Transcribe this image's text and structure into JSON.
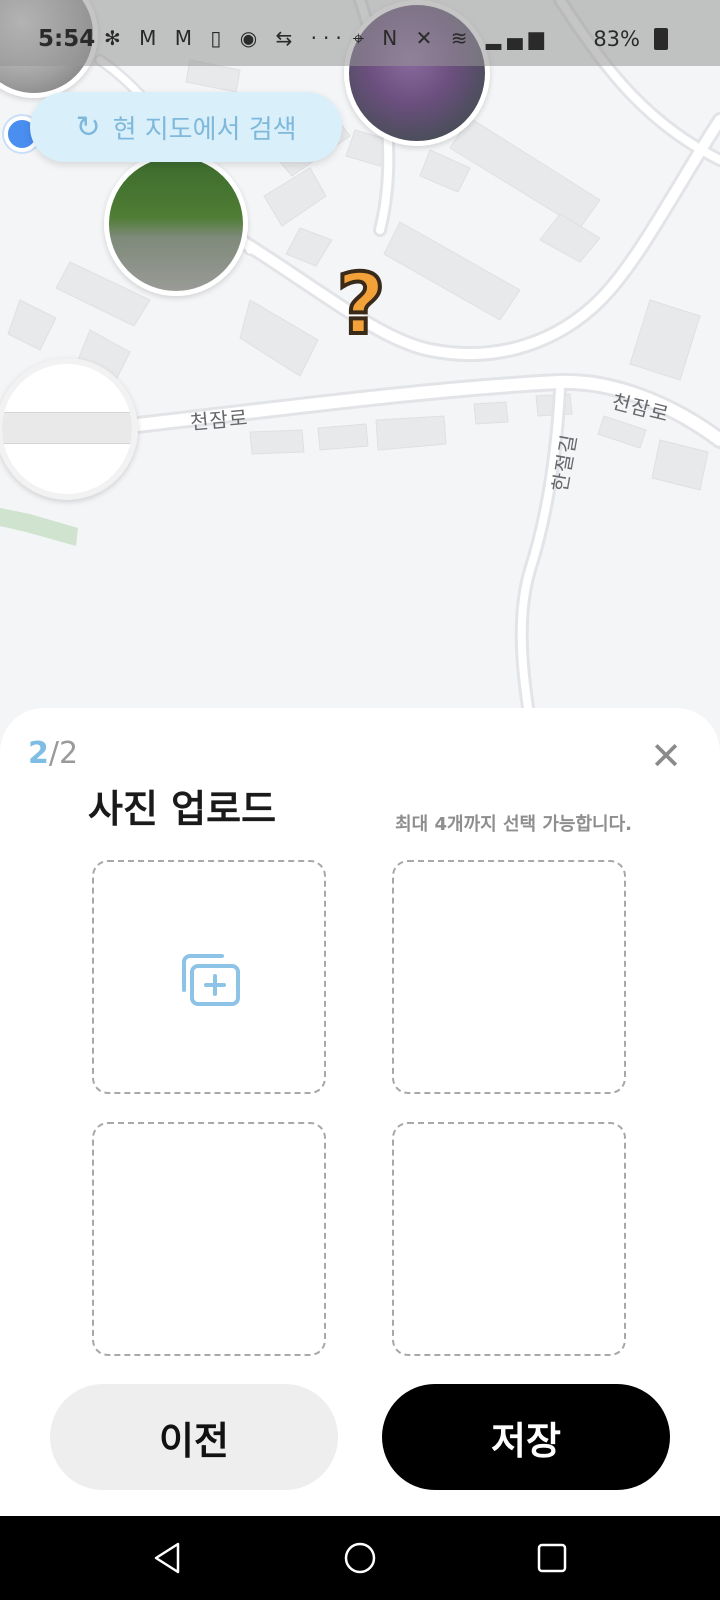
{
  "status_bar": {
    "time": "5:54",
    "left_icons": "✻ M M ▯ ◉ ⇆ ···",
    "right_icons": "⌖ N ✕ ≋ ▂▄▆",
    "battery": "83%"
  },
  "map": {
    "search_button_label": "현 지도에서 검색",
    "road_labels": [
      "천잠로",
      "천잠로",
      "한절길"
    ]
  },
  "sheet": {
    "step_current": "2",
    "step_total": "/2",
    "title": "사진 업로드",
    "hint": "최대 4개까지 선택 가능합니다.",
    "prev_label": "이전",
    "save_label": "저장"
  },
  "colors": {
    "accent": "#7fbde4",
    "search_pill_bg": "#d9f0fb",
    "primary_button_bg": "#000000",
    "secondary_button_bg": "#eeeeee"
  },
  "icons": {
    "refresh": "refresh-icon",
    "close": "close-icon",
    "add_photo": "add-photo-icon",
    "question_marker": "question-mark-icon",
    "nav_back": "nav-back-icon",
    "nav_home": "nav-home-icon",
    "nav_recents": "nav-recents-icon"
  }
}
